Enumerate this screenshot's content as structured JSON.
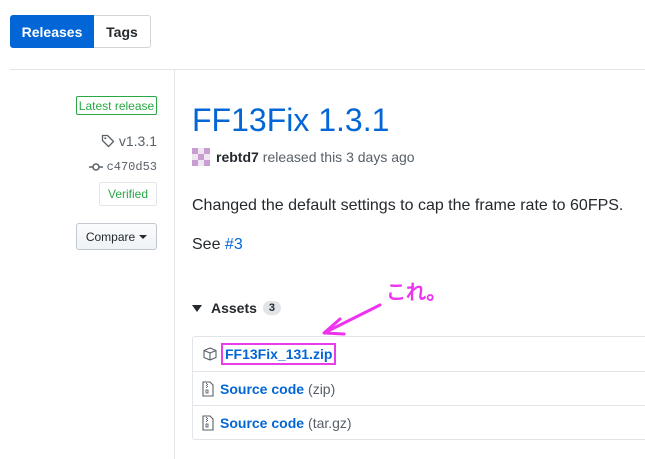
{
  "tabs": {
    "releases": "Releases",
    "tags": "Tags"
  },
  "sidebar": {
    "latest_badge": "Latest release",
    "tag": "v1.3.1",
    "commit": "c470d53",
    "verified": "Verified",
    "compare": "Compare"
  },
  "release": {
    "title": "FF13Fix 1.3.1",
    "author": "rebtd7",
    "released_text": "released this 3 days ago",
    "body": "Changed the default settings to cap the frame rate to 60FPS.",
    "see_label": "See",
    "see_link": "#3"
  },
  "assets": {
    "label": "Assets",
    "count": "3",
    "items": [
      {
        "name": "FF13Fix_131.zip",
        "ext": ""
      },
      {
        "name": "Source code",
        "ext": "(zip)"
      },
      {
        "name": "Source code",
        "ext": "(tar.gz)"
      }
    ]
  },
  "annotation": {
    "text": "これ。",
    "color": "#ee33ee"
  },
  "colors": {
    "accent": "#0366d6",
    "success": "#28a745",
    "annotation": "#ee33ee"
  },
  "icons": [
    "tag-icon",
    "commit-icon",
    "package-icon",
    "file-zip-icon",
    "caret-down-icon",
    "triangle-down-icon"
  ]
}
